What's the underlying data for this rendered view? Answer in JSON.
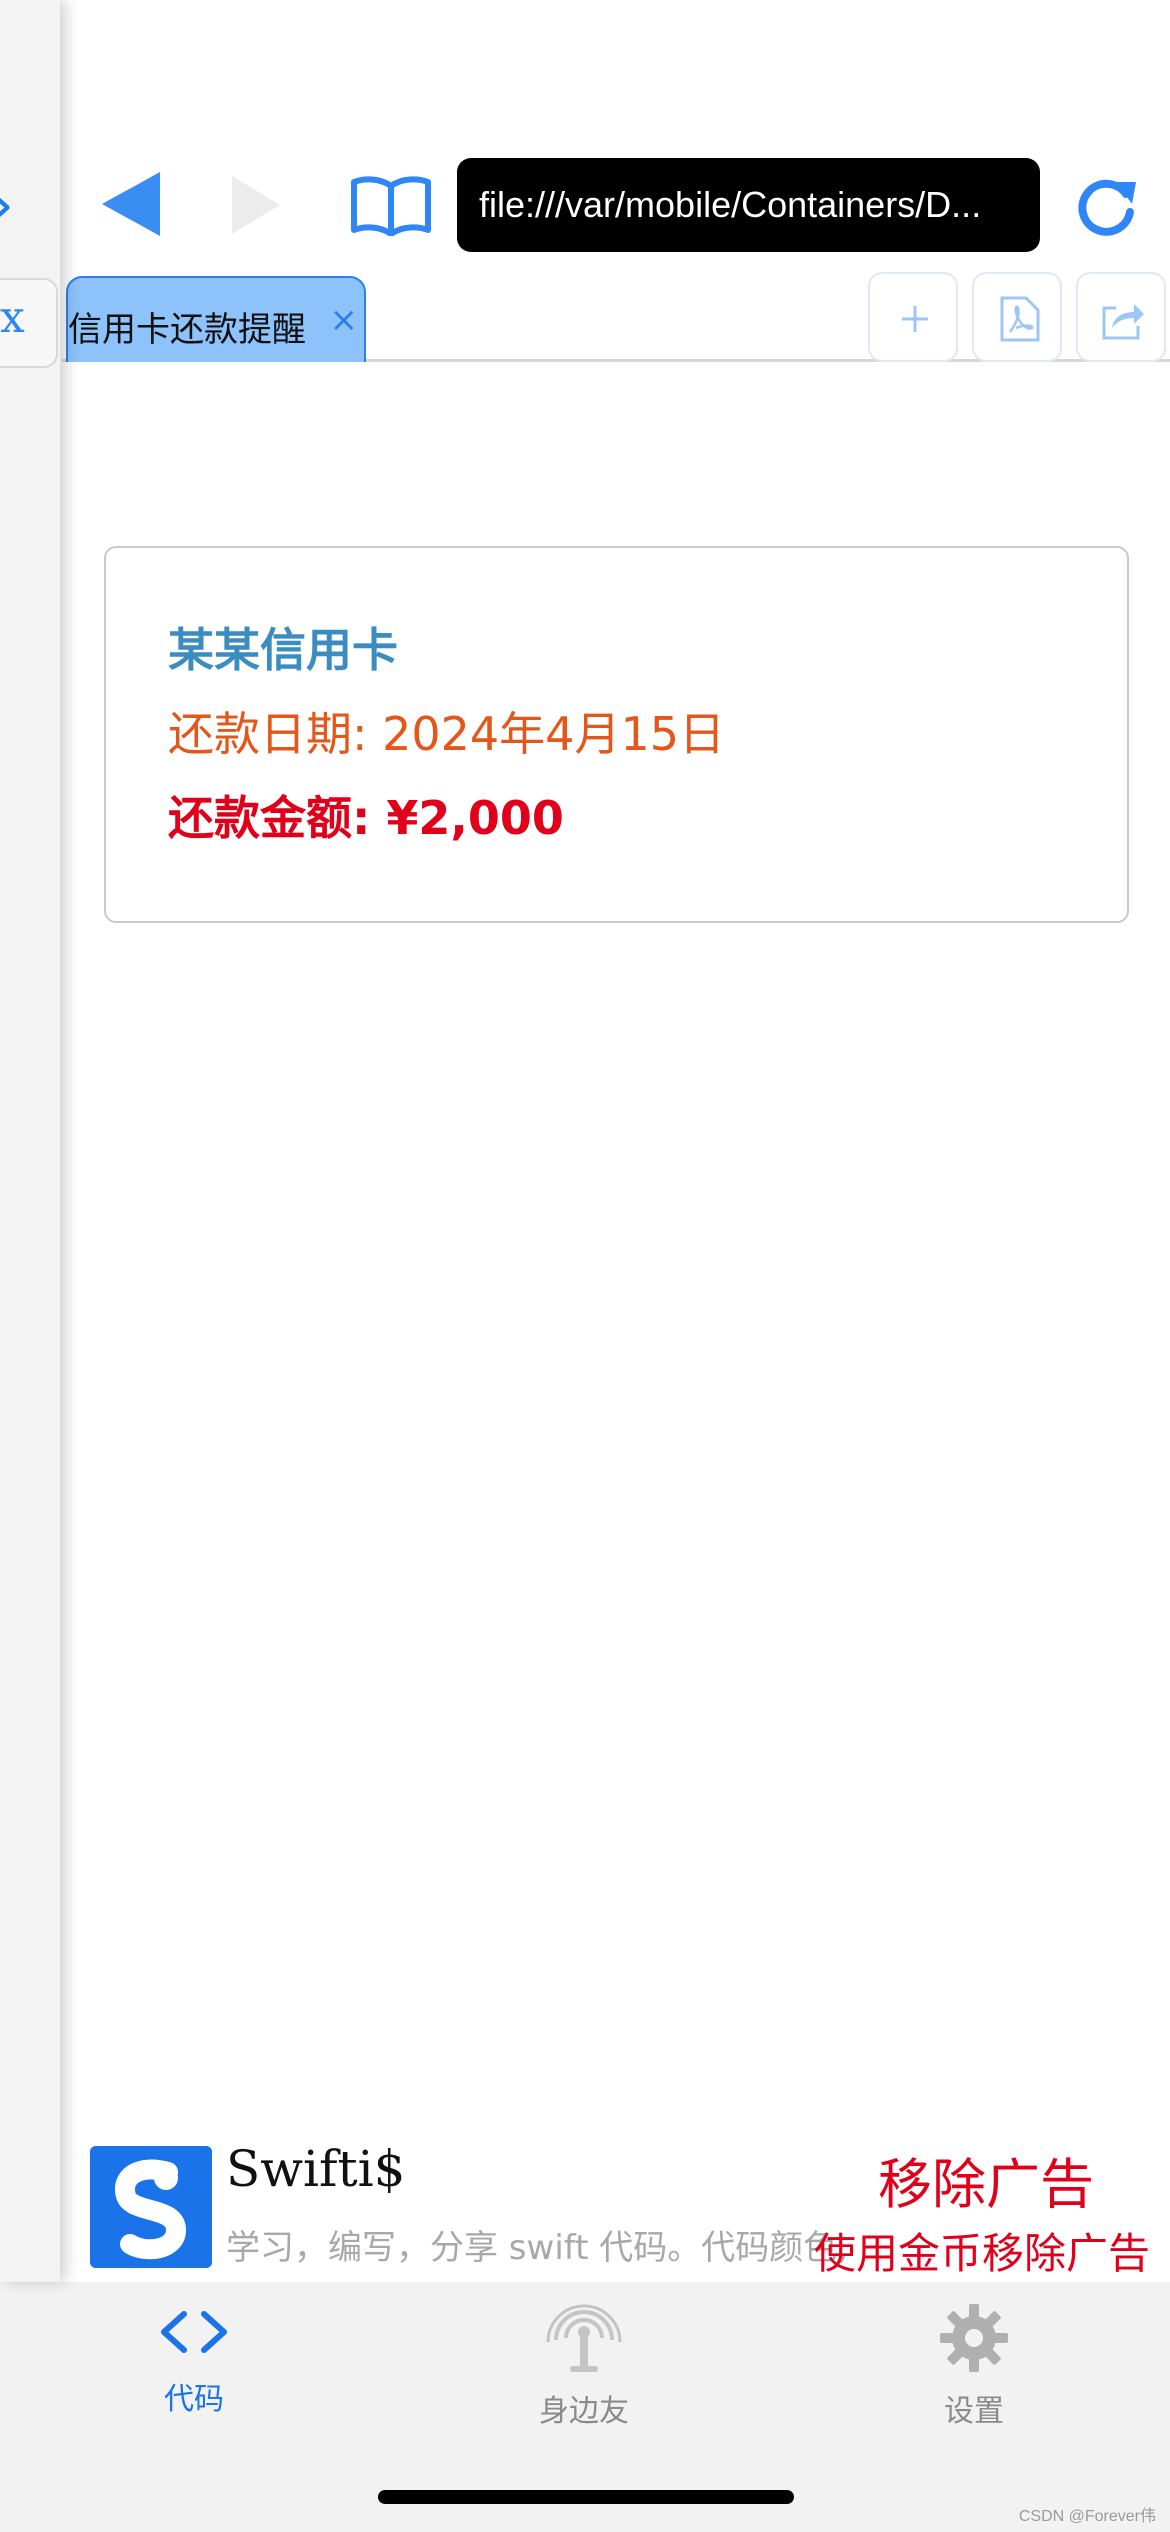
{
  "toolbar": {
    "url": "file:///var/mobile/Containers/D..."
  },
  "left_panel": {
    "tab_close": "x"
  },
  "tabs": [
    {
      "label": "信用卡还款提醒",
      "close": "×"
    }
  ],
  "card": {
    "title": "某某信用卡",
    "due_date": "还款日期: 2024年4月15日",
    "amount": "还款金额: ¥2,000"
  },
  "ad": {
    "app_name": "Swifti$",
    "description": "学习，编写，分享 swift 代码。代码颜色,",
    "remove_ad": "移除广告",
    "use_coins": "使用金币移除广告"
  },
  "tabbar": {
    "items": [
      {
        "label": "代码",
        "icon": "code-icon",
        "active": true
      },
      {
        "label": "身边友",
        "icon": "antenna-icon",
        "active": false
      },
      {
        "label": "设置",
        "icon": "gear-icon",
        "active": false
      }
    ]
  },
  "watermark": "CSDN @Forever伟",
  "colors": {
    "accent": "#1a73e8",
    "tab_active_bg": "#8dc2fb",
    "card_title": "#3b8cc0",
    "due_date": "#e4561a",
    "amount": "#e1001a"
  }
}
